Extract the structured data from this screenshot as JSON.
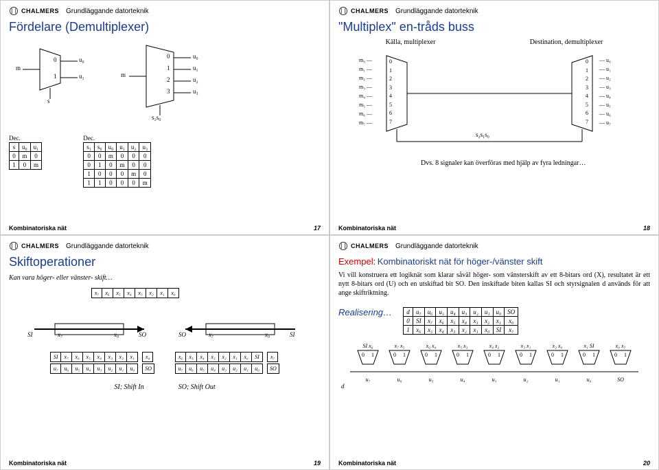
{
  "brand": "CHALMERS",
  "course": "Grundläggande datorteknik",
  "footer": "Kombinatoriska nät",
  "slides": {
    "s17": {
      "title": "Fördelare (Demultiplexer)",
      "page": "17",
      "tab1_caption": "Dec.",
      "tab2_caption": "Dec.",
      "t1": {
        "h": [
          "s",
          "u₀",
          "u₁"
        ],
        "r": [
          [
            "0",
            "m",
            "0"
          ],
          [
            "1",
            "0",
            "m"
          ]
        ]
      },
      "t2": {
        "h": [
          "s₁",
          "s₀",
          "u₀",
          "u₁",
          "u₂",
          "u₃"
        ],
        "r": [
          [
            "0",
            "0",
            "m",
            "0",
            "0",
            "0"
          ],
          [
            "0",
            "1",
            "0",
            "m",
            "0",
            "0"
          ],
          [
            "1",
            "0",
            "0",
            "0",
            "m",
            "0"
          ],
          [
            "1",
            "1",
            "0",
            "0",
            "0",
            "m"
          ]
        ]
      },
      "left_labels": {
        "m": "m",
        "s": "s",
        "zero": "0",
        "one": "1",
        "u0": "u₀",
        "u1": "u₁"
      },
      "right_labels": {
        "m": "m",
        "s": "s₁s₀",
        "n0": "0",
        "n1": "1",
        "n2": "2",
        "n3": "3",
        "u0": "u₀",
        "u1": "u₁",
        "u2": "u₂",
        "u3": "u₃"
      }
    },
    "s18": {
      "title": "\"Multiplex\" en-tråds buss",
      "page": "18",
      "src": "Källa, multiplexer",
      "dst": "Destination, demultiplexer",
      "mux_in": [
        "m₀",
        "m₁",
        "m₂",
        "m₃",
        "m₄",
        "m₅",
        "m₆",
        "m₇"
      ],
      "idx": [
        "0",
        "1",
        "2",
        "3",
        "4",
        "5",
        "6",
        "7"
      ],
      "demux_out": [
        "u₀",
        "u₁",
        "u₂",
        "u₃",
        "u₄",
        "u₅",
        "u₆",
        "u₇"
      ],
      "sel": "s₂s₁s₀",
      "note": "Dvs. 8 signaler kan överföras med hjälp av fyra ledningar…"
    },
    "s19": {
      "title": "Skiftoperationer",
      "page": "19",
      "sub": "Kan vara höger- eller vänster- skift…",
      "bits": [
        "x₇",
        "x₆",
        "x₅",
        "x₄",
        "x₃",
        "x₂",
        "x₁",
        "x₀"
      ],
      "si": "SI",
      "so": "SO",
      "si_label": "SI; Shift In",
      "so_label": "SO; Shift Out",
      "row_top_l": [
        "SI",
        "x₇",
        "x₆",
        "x₅",
        "x₄",
        "x₃",
        "x₂",
        "x₁"
      ],
      "row_top_r": [
        "x₆",
        "x₅",
        "x₄",
        "x₃",
        "x₂",
        "x₁",
        "x₀",
        "SI"
      ],
      "row_bot": [
        "u₇",
        "u₆",
        "u₅",
        "u₄",
        "u₃",
        "u₂",
        "u₁",
        "u₀"
      ],
      "extra_l": "x₀",
      "extra_r": "x₇"
    },
    "s20": {
      "page": "20",
      "ex": "Exempel:",
      "ex_title": "Kombinatoriskt nät för höger-/vänster skift",
      "para": "Vi vill konstruera ett logiknät som klarar såväl höger- som vänsterskift av ett 8-bitars ord (X), resultatet är ett nytt 8-bitars ord (U) och en utskiftad bit SO. Den inskiftade biten kallas SI och styrsignalen d används för att ange skiftriktning.",
      "real": "Realisering…",
      "tbl": {
        "h": [
          "d",
          "u₇",
          "u₆",
          "u₅",
          "u₄",
          "u₃",
          "u₂",
          "u₁",
          "u₀",
          "SO"
        ],
        "r": [
          [
            "0",
            "SI",
            "x₇",
            "x₆",
            "x₅",
            "x₄",
            "x₃",
            "x₂",
            "x₁",
            "x₀"
          ],
          [
            "1",
            "x₆",
            "x₅",
            "x₄",
            "x₃",
            "x₂",
            "x₁",
            "x₀",
            "SI",
            "x₇"
          ]
        ]
      },
      "mux_tops": [
        "SI x₆",
        "x₇ x₅",
        "x₆ x₄",
        "x₅ x₃",
        "x₄ x₂",
        "x₃ x₁",
        "x₂ x₀",
        "x₁ SI",
        "x₀ x₇"
      ],
      "mux_sel": [
        "0 1",
        "0 1",
        "0 1",
        "0 1",
        "0 1",
        "0 1",
        "0 1",
        "0 1",
        "0 1"
      ],
      "mux_out": [
        "u₇",
        "u₆",
        "u₅",
        "u₄",
        "u₃",
        "u₂",
        "u₁",
        "u₀",
        "SO"
      ],
      "d": "d"
    }
  }
}
